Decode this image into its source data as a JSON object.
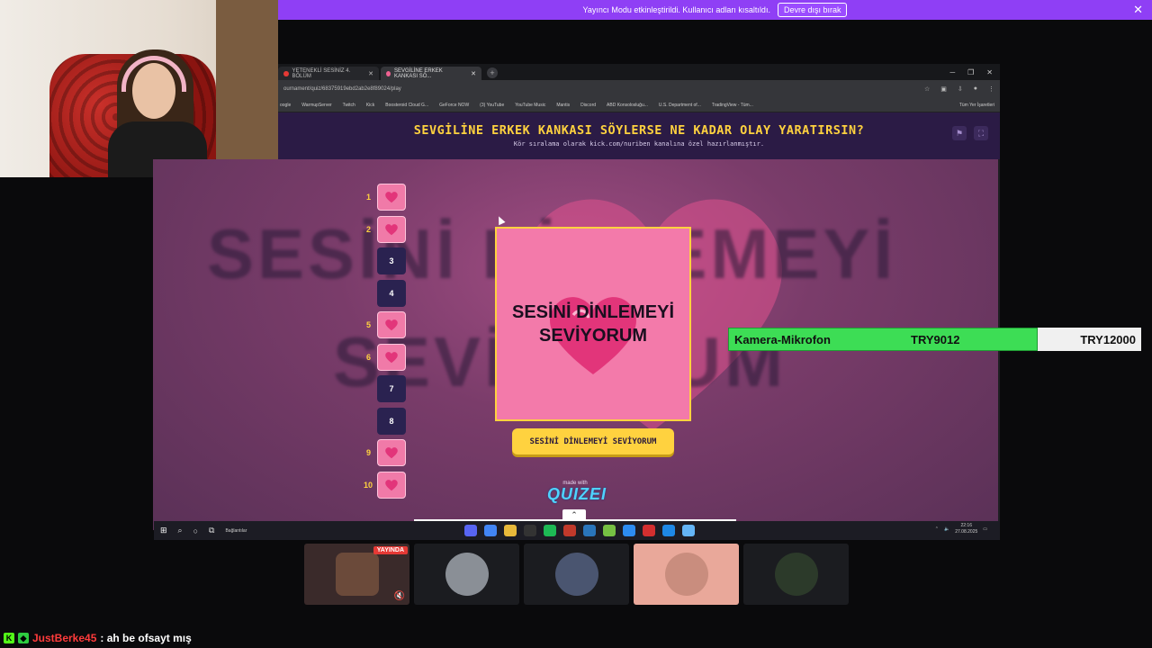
{
  "banner": {
    "text": "Yayıncı Modu etkinleştirildi. Kullanıcı adları kısaltıldı.",
    "button": "Devre dışı bırak"
  },
  "browser": {
    "tabs": [
      {
        "label": "YETENEKLİ SESİNİZ 4. BÖLÜM"
      },
      {
        "label": "SEVGİLİNE ERKEK KANKASI SÖ..."
      }
    ],
    "url": "ournament/quiz/68375919ebd2ab2e8f89024/play",
    "bookmarks": [
      "oogle",
      "WarmupServer",
      "Twitch",
      "Kick",
      "Boosteroid Cloud G...",
      "GeForce NOW",
      "(3) YouTube",
      "YouTube Music",
      "Mantis",
      "Discord",
      "ABD Konsolosluğu...",
      "U.S. Department of...",
      "TradingView - Tüm..."
    ],
    "all_bookmarks": "Tüm Yer İşaretleri"
  },
  "quiz": {
    "title": "SEVGİLİNE ERKEK KANKASI SÖYLERSE NE KADAR OLAY YARATIRSIN?",
    "subtitle": "Kör sıralama olarak kick.com/nuriben kanalına özel hazırlanmıştır.",
    "bg_line1": "SESİNİ DİNLEMEYİ",
    "bg_line2": "SEVİYORUM",
    "card_text": "SESİNİ DİNLEMEYİ SEVİYORUM",
    "choose_button": "SESİNİ DİNLEMEYİ SEVİYORUM",
    "made_with": "made with",
    "logo": "QUIZEI",
    "slots": [
      {
        "num": "1",
        "filled": true
      },
      {
        "num": "2",
        "filled": true
      },
      {
        "num": "3",
        "filled": false
      },
      {
        "num": "4",
        "filled": false
      },
      {
        "num": "5",
        "filled": true
      },
      {
        "num": "6",
        "filled": true
      },
      {
        "num": "7",
        "filled": false
      },
      {
        "num": "8",
        "filled": false
      },
      {
        "num": "9",
        "filled": true
      },
      {
        "num": "10",
        "filled": true
      }
    ]
  },
  "donation": {
    "label": "Kamera-Mikrofon",
    "current": "TRY9012",
    "goal": "TRY12000",
    "progress": 0.75
  },
  "taskbar": {
    "search_label": "Bağlantılar",
    "time": "22:16",
    "date": "27.08.2025"
  },
  "thumbnails": {
    "live_badge": "YAYINDA"
  },
  "chat": {
    "user": "JustBerke45",
    "message": ": ah be ofsayt mış"
  },
  "colors": {
    "accent_yellow": "#ffd23f",
    "banner_purple": "#8f3ff5",
    "card_pink": "#f37aaa",
    "donation_green": "#3ddd55"
  }
}
